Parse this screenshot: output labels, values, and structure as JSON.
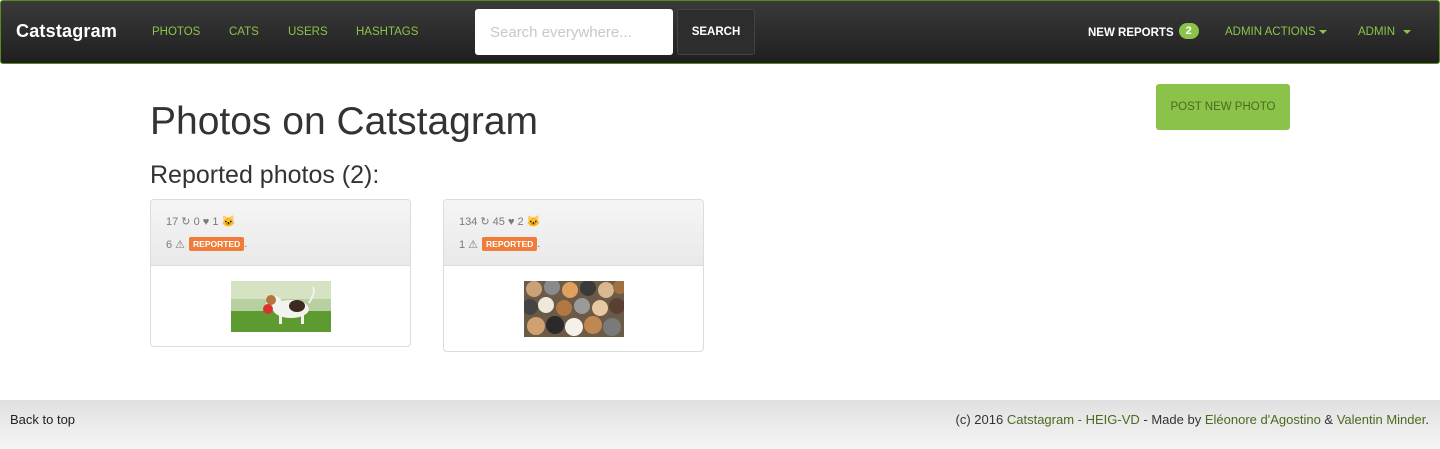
{
  "navbar": {
    "brand": "Catstagram",
    "links": [
      "PHOTOS",
      "CATS",
      "USERS",
      "HASHTAGS"
    ],
    "search_placeholder": "Search everywhere...",
    "search_button": "SEARCH",
    "new_reports_label": "NEW REPORTS",
    "new_reports_count": "2",
    "admin_actions_label": "ADMIN ACTIONS",
    "admin_label": "ADMIN"
  },
  "main": {
    "title": "Photos on Catstagram",
    "post_button": "POST NEW PHOTO",
    "reported_heading": "Reported photos (2):",
    "cards": [
      {
        "stats": "17 ↻ 0 ♥ 1 🐱",
        "report_count": "6 ⚠",
        "report_label": "REPORTED",
        "image": "puppy-photo"
      },
      {
        "stats": "134 ↻ 45 ♥ 2 🐱",
        "report_count": "1 ⚠",
        "report_label": "REPORTED",
        "image": "many-cats-photo"
      }
    ]
  },
  "footer": {
    "back_to_top": "Back to top",
    "copyright": "(c) 2016",
    "site_link": "Catstagram - HEIG-VD",
    "made_by": "- Made by",
    "author1": "Eléonore d'Agostino",
    "and": "&",
    "author2": "Valentin Minder",
    "period": "."
  },
  "colors": {
    "accent": "#8bc34a",
    "reported": "#f07c3a",
    "navbar": "#2a2a2a"
  }
}
